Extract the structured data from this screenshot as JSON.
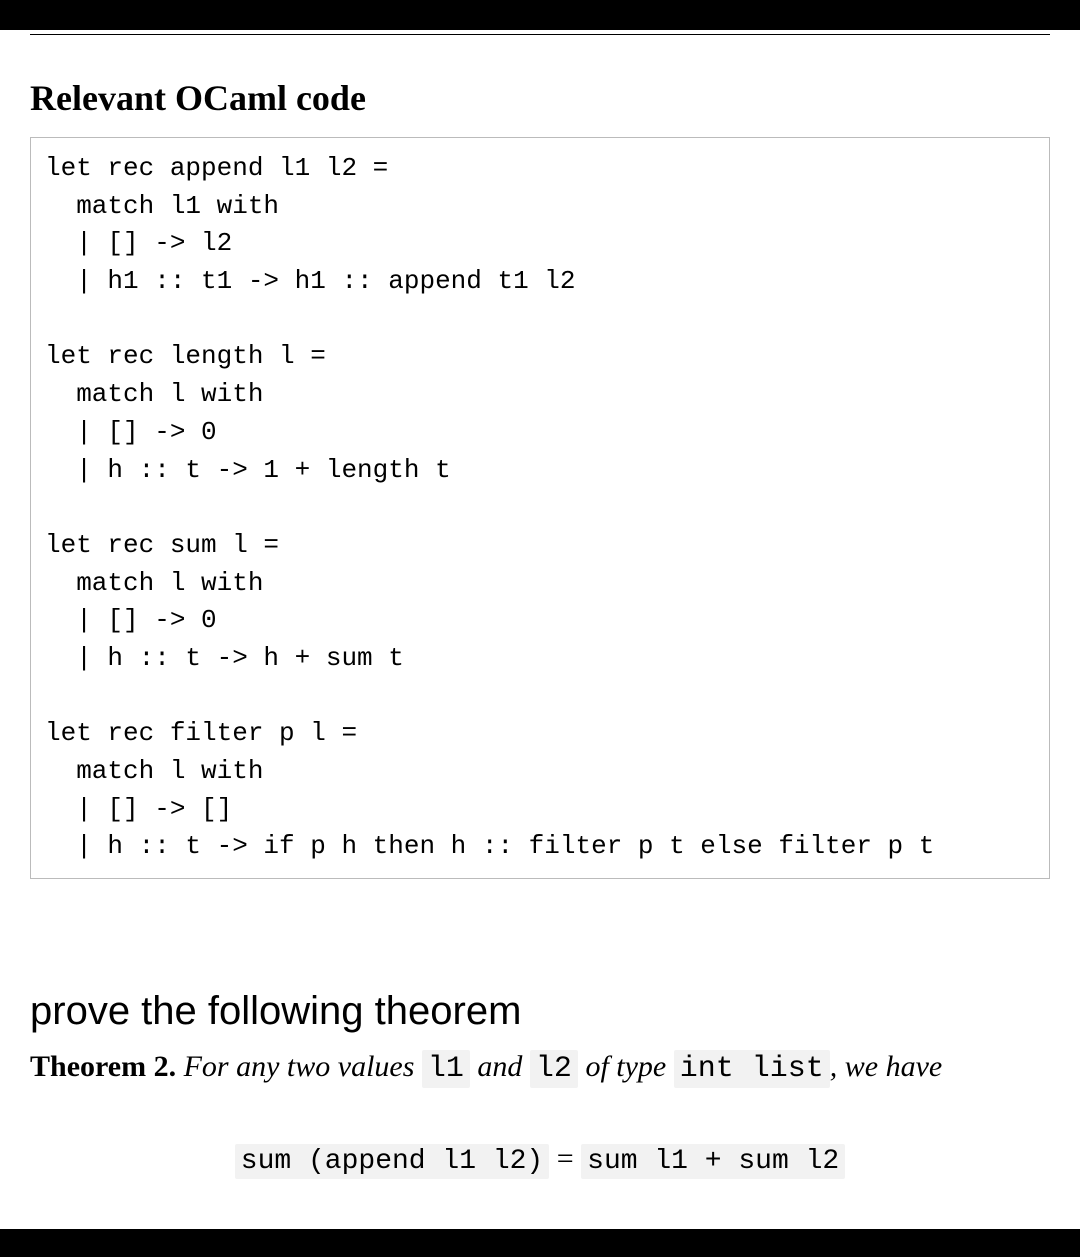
{
  "section_title": "Relevant OCaml code",
  "code": "let rec append l1 l2 =\n  match l1 with\n  | [] -> l2\n  | h1 :: t1 -> h1 :: append t1 l2\n\nlet rec length l =\n  match l with\n  | [] -> 0\n  | h :: t -> 1 + length t\n\nlet rec sum l =\n  match l with\n  | [] -> 0\n  | h :: t -> h + sum t\n\nlet rec filter p l =\n  match l with\n  | [] -> []\n  | h :: t -> if p h then h :: filter p t else filter p t",
  "prompt": "prove the following theorem",
  "theorem": {
    "label": "Theorem 2.",
    "prefix": "For any two values ",
    "code1": "l1",
    "mid1": " and ",
    "code2": "l2",
    "mid2": " of type ",
    "code3": "int list",
    "suffix": ", we have"
  },
  "equation": {
    "lhs": "sum (append l1 l2)",
    "eq": " = ",
    "rhs": "sum l1 + sum l2"
  }
}
